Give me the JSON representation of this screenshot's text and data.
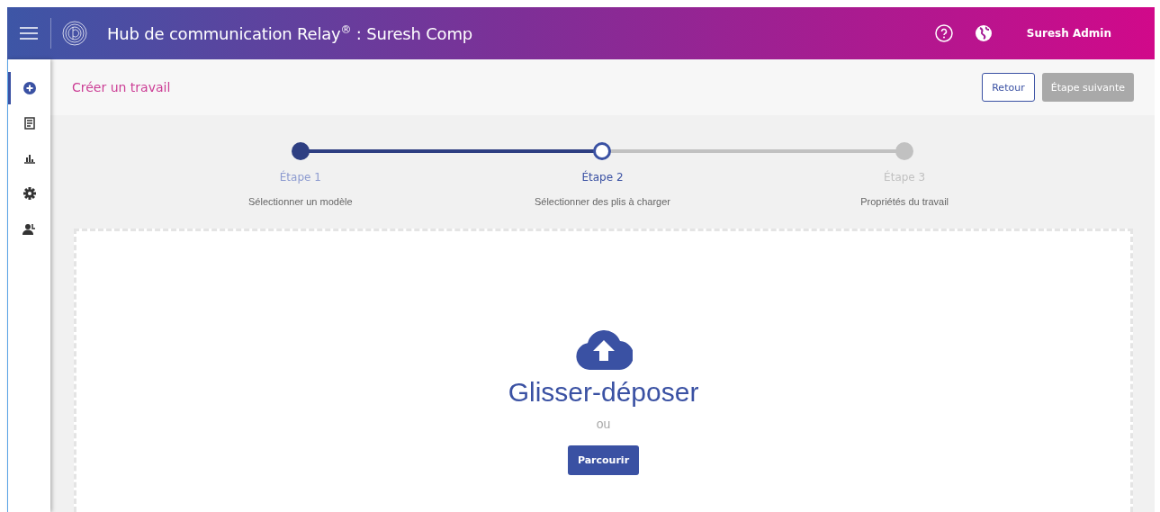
{
  "header": {
    "title": "Hub de communication Relay",
    "title_mark": "®",
    "title_suffix": " :  Suresh Comp",
    "user": "Suresh Admin"
  },
  "sidebar": {
    "items": [
      {
        "kind": "add",
        "selected": true
      },
      {
        "kind": "document",
        "selected": false
      },
      {
        "kind": "chart",
        "selected": false
      },
      {
        "kind": "settings",
        "selected": false
      },
      {
        "kind": "users",
        "selected": false
      }
    ]
  },
  "page": {
    "title": "Créer un travail",
    "buttons": [
      {
        "label": "Retour",
        "disabled": false,
        "kind": "outline"
      },
      {
        "label": "Étape suivante",
        "disabled": true,
        "kind": "primary"
      }
    ]
  },
  "stepper": {
    "steps": [
      {
        "label": "Étape 1",
        "description": "Sélectionner un modèle",
        "completed": true,
        "selected": false
      },
      {
        "label": "Étape 2",
        "description": "Sélectionner des plis à charger",
        "completed": false,
        "selected": true
      },
      {
        "label": "Étape 3",
        "description": "Propriétés du travail",
        "completed": false,
        "selected": false
      }
    ]
  },
  "dropzone": {
    "title": "Glisser-déposer",
    "separator": "ou",
    "button": "Parcourir"
  }
}
